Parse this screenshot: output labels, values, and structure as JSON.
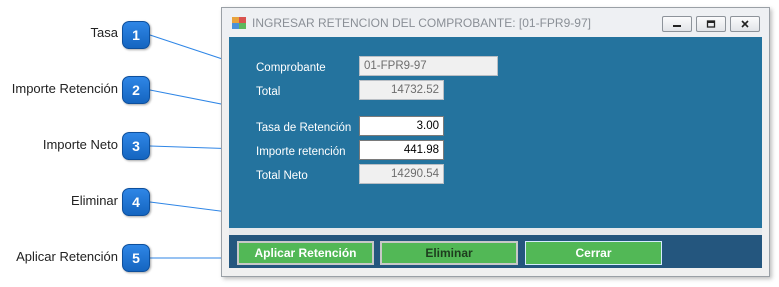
{
  "callouts": [
    {
      "number": "1",
      "label": "Tasa"
    },
    {
      "number": "2",
      "label": "Importe Retención"
    },
    {
      "number": "3",
      "label": "Importe Neto"
    },
    {
      "number": "4",
      "label": "Eliminar"
    },
    {
      "number": "5",
      "label": "Aplicar Retención"
    }
  ],
  "window": {
    "title": "INGRESAR RETENCION DEL COMPROBANTE: [01-FPR9-97]",
    "icon": "app-form-icon",
    "controls": [
      "minimize-icon",
      "restore-icon",
      "close-icon"
    ]
  },
  "form": {
    "comprobante_label": "Comprobante",
    "comprobante_value": "01-FPR9-97",
    "total_label": "Total",
    "total_value": "14732.52",
    "tasa_label": "Tasa de Retención",
    "tasa_value": "3.00",
    "importe_label": "Importe retención",
    "importe_value": "441.98",
    "neto_label": "Total Neto",
    "neto_value": "14290.54"
  },
  "buttons": {
    "aplicar": "Aplicar Retención",
    "eliminar": "Eliminar",
    "cerrar": "Cerrar"
  },
  "colors": {
    "panel": "#24739e",
    "button_panel": "#24567e",
    "button": "#52b856",
    "badge": "#1f76d8"
  }
}
